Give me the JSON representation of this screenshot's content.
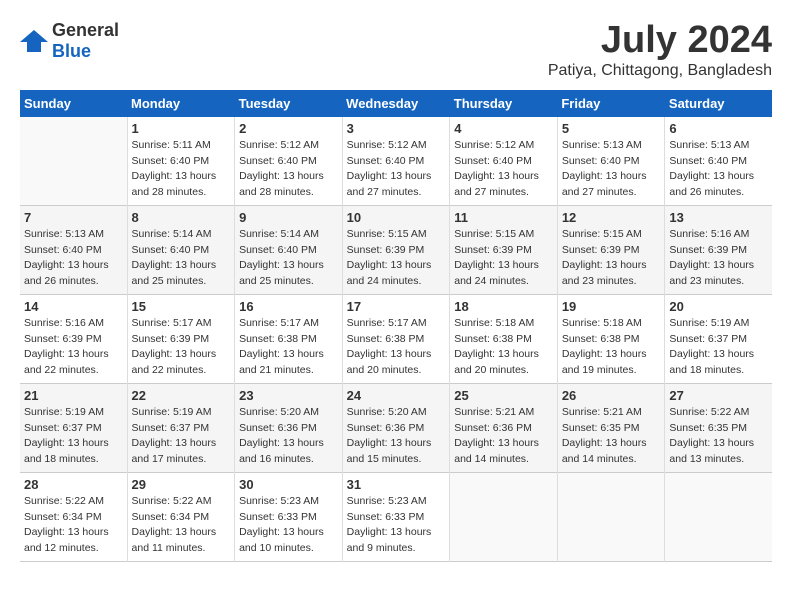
{
  "header": {
    "logo_general": "General",
    "logo_blue": "Blue",
    "title": "July 2024",
    "subtitle": "Patiya, Chittagong, Bangladesh"
  },
  "calendar": {
    "weekdays": [
      "Sunday",
      "Monday",
      "Tuesday",
      "Wednesday",
      "Thursday",
      "Friday",
      "Saturday"
    ],
    "weeks": [
      [
        {
          "day": "",
          "info": ""
        },
        {
          "day": "1",
          "info": "Sunrise: 5:11 AM\nSunset: 6:40 PM\nDaylight: 13 hours\nand 28 minutes."
        },
        {
          "day": "2",
          "info": "Sunrise: 5:12 AM\nSunset: 6:40 PM\nDaylight: 13 hours\nand 28 minutes."
        },
        {
          "day": "3",
          "info": "Sunrise: 5:12 AM\nSunset: 6:40 PM\nDaylight: 13 hours\nand 27 minutes."
        },
        {
          "day": "4",
          "info": "Sunrise: 5:12 AM\nSunset: 6:40 PM\nDaylight: 13 hours\nand 27 minutes."
        },
        {
          "day": "5",
          "info": "Sunrise: 5:13 AM\nSunset: 6:40 PM\nDaylight: 13 hours\nand 27 minutes."
        },
        {
          "day": "6",
          "info": "Sunrise: 5:13 AM\nSunset: 6:40 PM\nDaylight: 13 hours\nand 26 minutes."
        }
      ],
      [
        {
          "day": "7",
          "info": "Sunrise: 5:13 AM\nSunset: 6:40 PM\nDaylight: 13 hours\nand 26 minutes."
        },
        {
          "day": "8",
          "info": "Sunrise: 5:14 AM\nSunset: 6:40 PM\nDaylight: 13 hours\nand 25 minutes."
        },
        {
          "day": "9",
          "info": "Sunrise: 5:14 AM\nSunset: 6:40 PM\nDaylight: 13 hours\nand 25 minutes."
        },
        {
          "day": "10",
          "info": "Sunrise: 5:15 AM\nSunset: 6:39 PM\nDaylight: 13 hours\nand 24 minutes."
        },
        {
          "day": "11",
          "info": "Sunrise: 5:15 AM\nSunset: 6:39 PM\nDaylight: 13 hours\nand 24 minutes."
        },
        {
          "day": "12",
          "info": "Sunrise: 5:15 AM\nSunset: 6:39 PM\nDaylight: 13 hours\nand 23 minutes."
        },
        {
          "day": "13",
          "info": "Sunrise: 5:16 AM\nSunset: 6:39 PM\nDaylight: 13 hours\nand 23 minutes."
        }
      ],
      [
        {
          "day": "14",
          "info": "Sunrise: 5:16 AM\nSunset: 6:39 PM\nDaylight: 13 hours\nand 22 minutes."
        },
        {
          "day": "15",
          "info": "Sunrise: 5:17 AM\nSunset: 6:39 PM\nDaylight: 13 hours\nand 22 minutes."
        },
        {
          "day": "16",
          "info": "Sunrise: 5:17 AM\nSunset: 6:38 PM\nDaylight: 13 hours\nand 21 minutes."
        },
        {
          "day": "17",
          "info": "Sunrise: 5:17 AM\nSunset: 6:38 PM\nDaylight: 13 hours\nand 20 minutes."
        },
        {
          "day": "18",
          "info": "Sunrise: 5:18 AM\nSunset: 6:38 PM\nDaylight: 13 hours\nand 20 minutes."
        },
        {
          "day": "19",
          "info": "Sunrise: 5:18 AM\nSunset: 6:38 PM\nDaylight: 13 hours\nand 19 minutes."
        },
        {
          "day": "20",
          "info": "Sunrise: 5:19 AM\nSunset: 6:37 PM\nDaylight: 13 hours\nand 18 minutes."
        }
      ],
      [
        {
          "day": "21",
          "info": "Sunrise: 5:19 AM\nSunset: 6:37 PM\nDaylight: 13 hours\nand 18 minutes."
        },
        {
          "day": "22",
          "info": "Sunrise: 5:19 AM\nSunset: 6:37 PM\nDaylight: 13 hours\nand 17 minutes."
        },
        {
          "day": "23",
          "info": "Sunrise: 5:20 AM\nSunset: 6:36 PM\nDaylight: 13 hours\nand 16 minutes."
        },
        {
          "day": "24",
          "info": "Sunrise: 5:20 AM\nSunset: 6:36 PM\nDaylight: 13 hours\nand 15 minutes."
        },
        {
          "day": "25",
          "info": "Sunrise: 5:21 AM\nSunset: 6:36 PM\nDaylight: 13 hours\nand 14 minutes."
        },
        {
          "day": "26",
          "info": "Sunrise: 5:21 AM\nSunset: 6:35 PM\nDaylight: 13 hours\nand 14 minutes."
        },
        {
          "day": "27",
          "info": "Sunrise: 5:22 AM\nSunset: 6:35 PM\nDaylight: 13 hours\nand 13 minutes."
        }
      ],
      [
        {
          "day": "28",
          "info": "Sunrise: 5:22 AM\nSunset: 6:34 PM\nDaylight: 13 hours\nand 12 minutes."
        },
        {
          "day": "29",
          "info": "Sunrise: 5:22 AM\nSunset: 6:34 PM\nDaylight: 13 hours\nand 11 minutes."
        },
        {
          "day": "30",
          "info": "Sunrise: 5:23 AM\nSunset: 6:33 PM\nDaylight: 13 hours\nand 10 minutes."
        },
        {
          "day": "31",
          "info": "Sunrise: 5:23 AM\nSunset: 6:33 PM\nDaylight: 13 hours\nand 9 minutes."
        },
        {
          "day": "",
          "info": ""
        },
        {
          "day": "",
          "info": ""
        },
        {
          "day": "",
          "info": ""
        }
      ]
    ]
  }
}
